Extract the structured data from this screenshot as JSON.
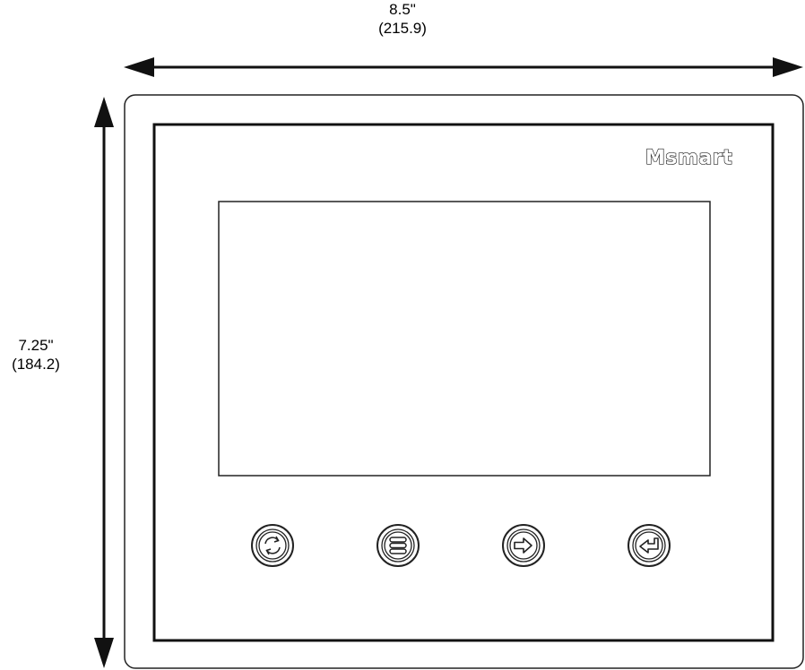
{
  "dimensions": {
    "width": {
      "inches": "8.5\"",
      "mm": "(215.9)"
    },
    "height": {
      "inches": "7.25\"",
      "mm": "(184.2)"
    }
  },
  "device": {
    "brand": "Msmart",
    "buttons": [
      {
        "icon": "refresh-icon"
      },
      {
        "icon": "menu-icon"
      },
      {
        "icon": "arrow-right-icon"
      },
      {
        "icon": "enter-return-icon"
      }
    ]
  },
  "colors": {
    "line": "#111111",
    "background": "#ffffff"
  }
}
